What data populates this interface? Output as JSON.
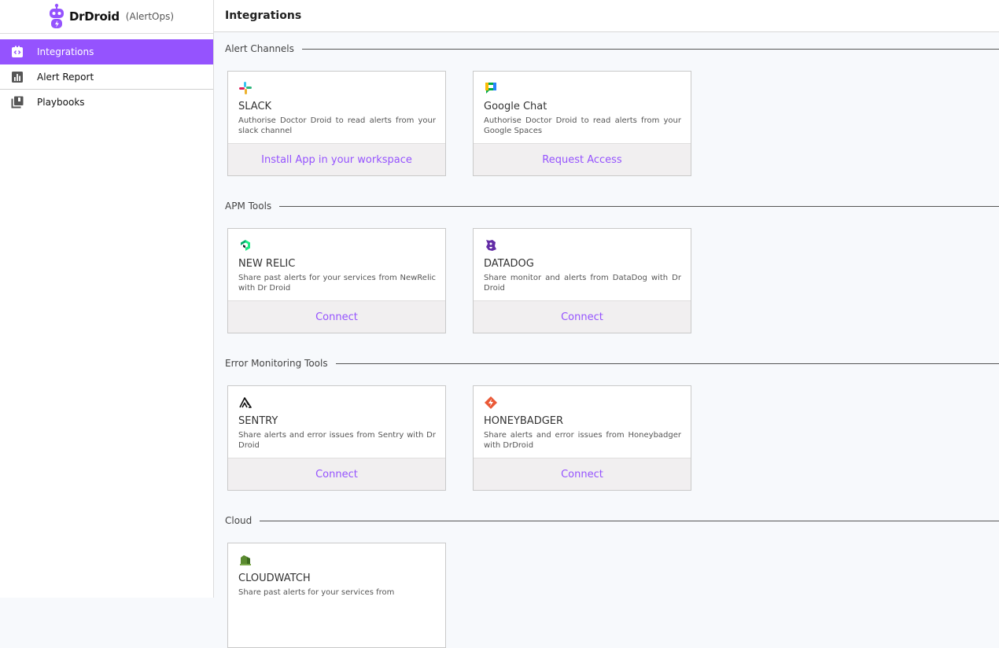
{
  "brand": {
    "name": "DrDroid",
    "product": "(AlertOps)"
  },
  "sidebar": {
    "items": [
      {
        "label": "Integrations",
        "active": true
      },
      {
        "label": "Alert Report"
      },
      {
        "label": "Playbooks"
      }
    ]
  },
  "header": {
    "title": "Integrations"
  },
  "sections": [
    {
      "title": "Alert Channels",
      "cards": [
        {
          "name": "SLACK",
          "description": "Authorise Doctor Droid to read alerts from your slack channel",
          "action": "Install App in your workspace",
          "icon": "slack-icon"
        },
        {
          "name": "Google Chat",
          "description": "Authorise Doctor Droid to read alerts from your Google Spaces",
          "action": "Request Access",
          "icon": "google-chat-icon"
        }
      ]
    },
    {
      "title": "APM Tools",
      "cards": [
        {
          "name": "NEW RELIC",
          "description": "Share past alerts for your services from NewRelic with Dr Droid",
          "action": "Connect",
          "icon": "new-relic-icon"
        },
        {
          "name": "DATADOG",
          "description": "Share monitor and alerts from DataDog with Dr Droid",
          "action": "Connect",
          "icon": "datadog-icon"
        }
      ]
    },
    {
      "title": "Error Monitoring Tools",
      "cards": [
        {
          "name": "SENTRY",
          "description": "Share alerts and error issues from Sentry with Dr Droid",
          "action": "Connect",
          "icon": "sentry-icon"
        },
        {
          "name": "HONEYBADGER",
          "description": "Share alerts and error issues from Honeybadger with DrDroid",
          "action": "Connect",
          "icon": "honeybadger-icon"
        }
      ]
    },
    {
      "title": "Cloud",
      "cards": [
        {
          "name": "CLOUDWATCH",
          "description": "Share past alerts for your services from",
          "icon": "cloudwatch-icon"
        }
      ]
    }
  ],
  "colors": {
    "accent": "#9553fe",
    "sidebar_active": "#9553fe",
    "action_bg": "#f1eff0"
  }
}
